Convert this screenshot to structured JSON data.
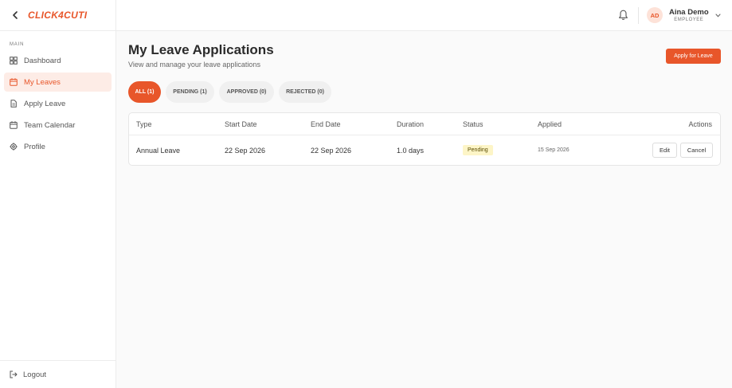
{
  "sidebar": {
    "logo": "CLICK4CUTI",
    "section_label": "MAIN",
    "items": [
      {
        "label": "Dashboard",
        "icon": "grid-icon"
      },
      {
        "label": "My Leaves",
        "icon": "calendar-icon"
      },
      {
        "label": "Apply Leave",
        "icon": "document-icon"
      },
      {
        "label": "Team Calendar",
        "icon": "calendar-icon"
      },
      {
        "label": "Profile",
        "icon": "gear-icon"
      }
    ],
    "logout_label": "Logout"
  },
  "header": {
    "user": {
      "initials": "AD",
      "name": "Aina Demo",
      "role": "EMPLOYEE"
    }
  },
  "main": {
    "title": "My Leave Applications",
    "subtitle": "View and manage your leave applications",
    "apply_button": "Apply for Leave",
    "tabs": [
      {
        "label": "ALL (1)",
        "active": true
      },
      {
        "label": "PENDING (1)",
        "active": false
      },
      {
        "label": "APPROVED (0)",
        "active": false
      },
      {
        "label": "REJECTED (0)",
        "active": false
      }
    ],
    "table": {
      "columns": [
        "Type",
        "Start Date",
        "End Date",
        "Duration",
        "Status",
        "Applied",
        "Actions"
      ],
      "rows": [
        {
          "type": "Annual Leave",
          "start_date": "22 Sep 2026",
          "end_date": "22 Sep 2026",
          "duration": "1.0 days",
          "status": "Pending",
          "applied": "15 Sep 2026",
          "edit_label": "Edit",
          "cancel_label": "Cancel"
        }
      ]
    }
  },
  "colors": {
    "accent": "#e8562a",
    "accent_light": "#fdece6",
    "pending_badge": "#fdf5c7"
  }
}
